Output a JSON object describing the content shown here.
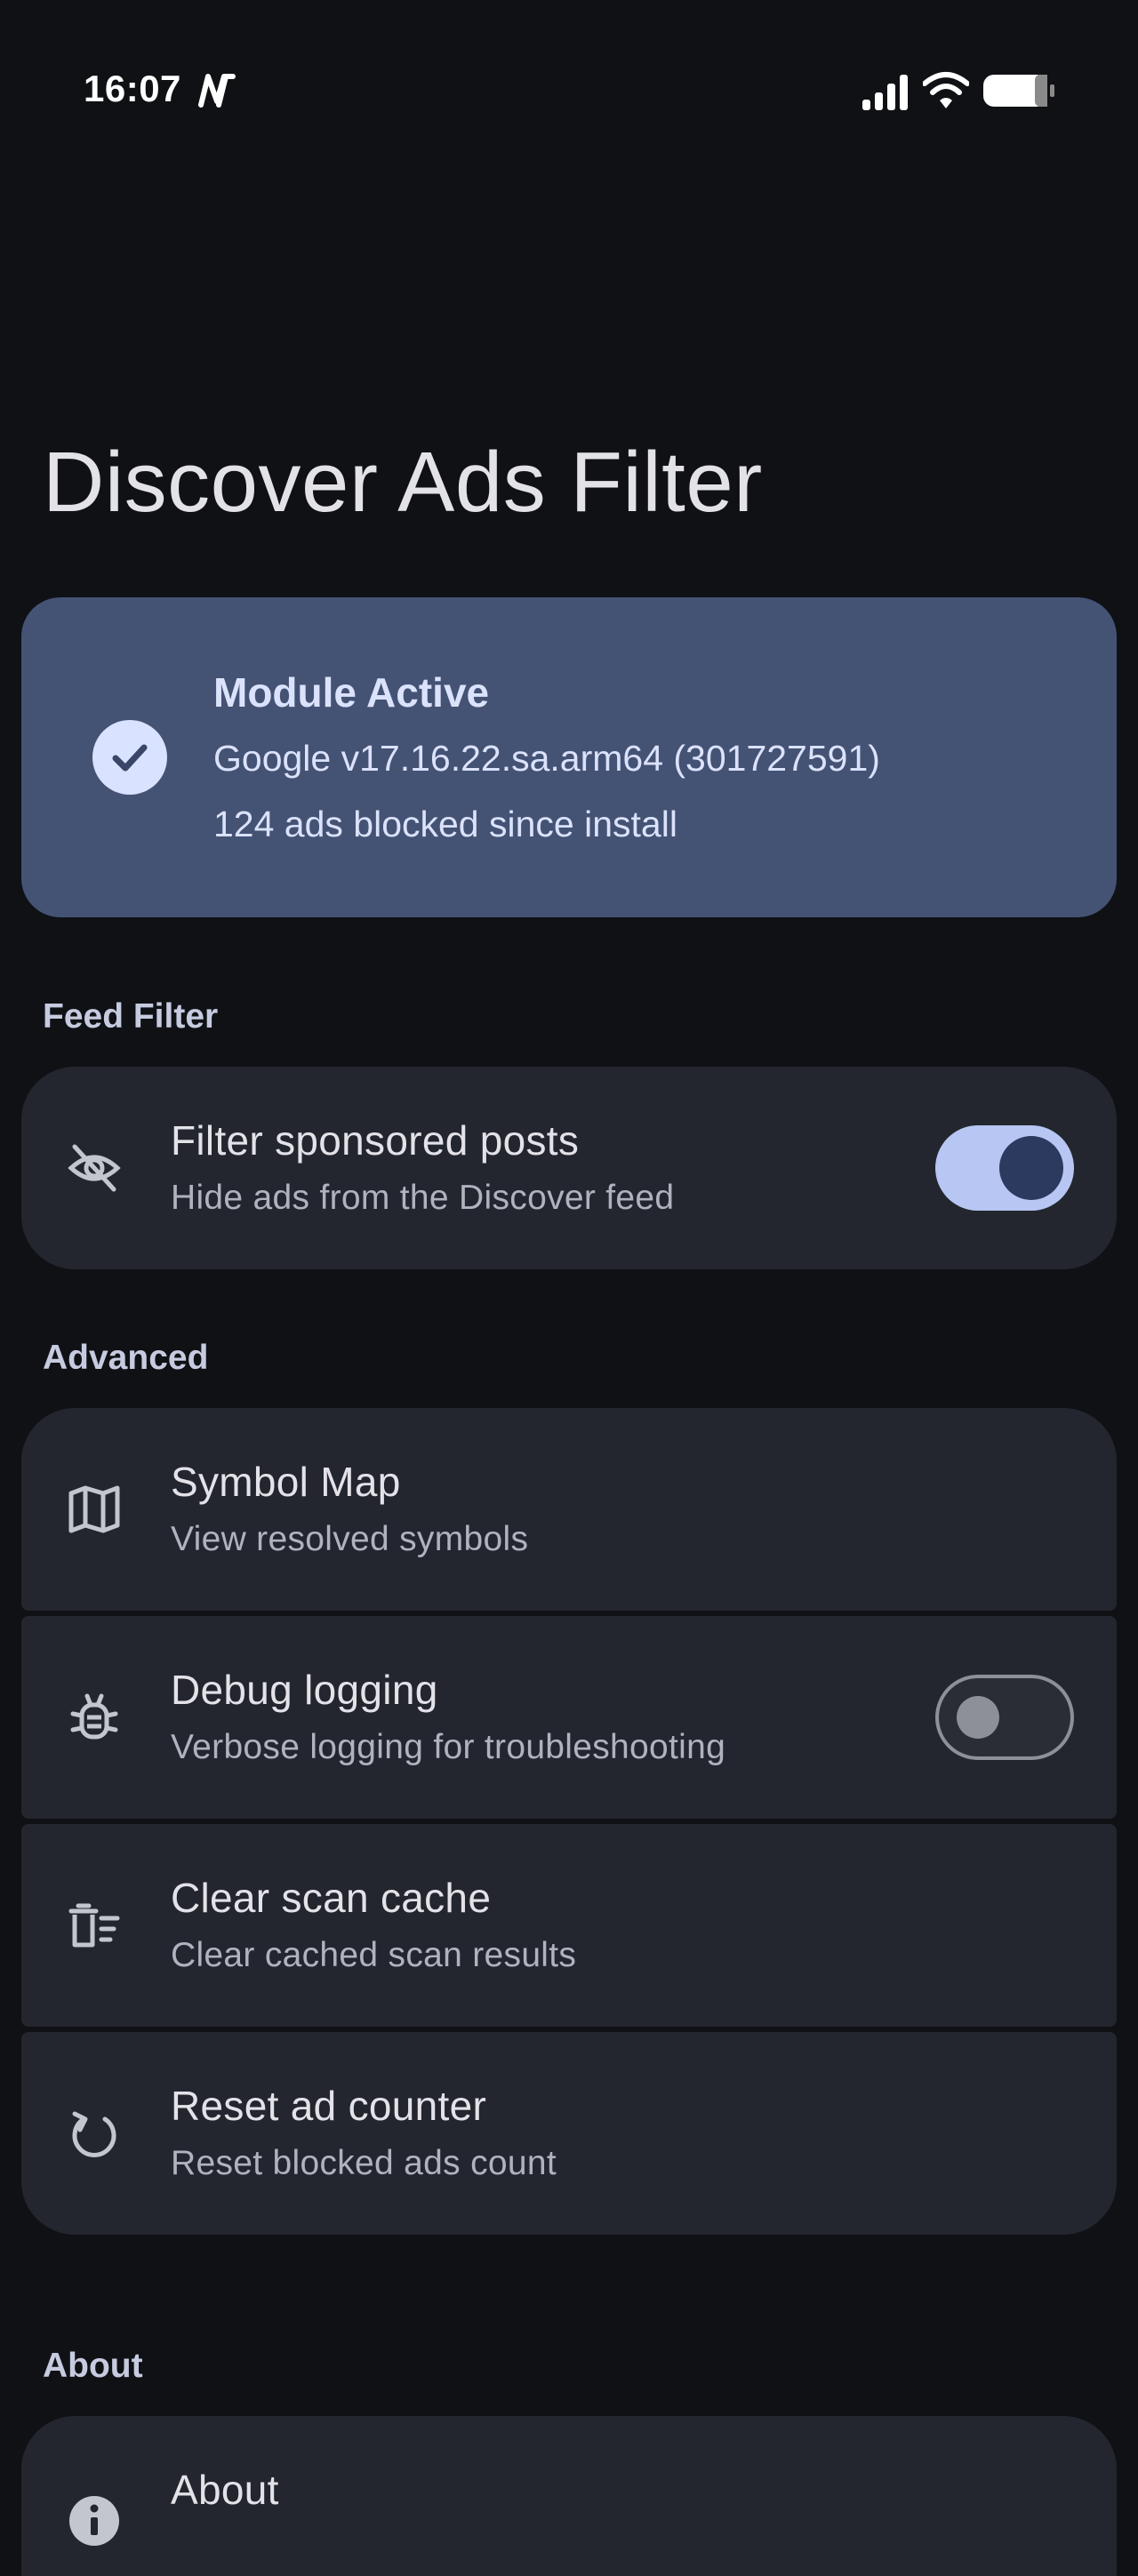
{
  "status_bar": {
    "time": "16:07",
    "app_icon": "n-notification-icon",
    "signal_icon": "cell-signal-icon",
    "wifi_icon": "wifi-icon",
    "battery_icon": "battery-icon"
  },
  "app": {
    "title": "Discover Ads Filter"
  },
  "module_card": {
    "title": "Module Active",
    "version": "Google v17.16.22.sa.arm64 (301727591)",
    "blocked": "124 ads blocked since install",
    "icon": "check-circle-icon"
  },
  "sections": {
    "feed_filter": {
      "label": "Feed Filter",
      "items": [
        {
          "title": "Filter sponsored posts",
          "subtitle": "Hide ads from the Discover feed",
          "icon": "eye-off-icon",
          "toggle": true
        }
      ]
    },
    "advanced": {
      "label": "Advanced",
      "items": [
        {
          "title": "Symbol Map",
          "subtitle": "View resolved symbols",
          "icon": "map-icon"
        },
        {
          "title": "Debug logging",
          "subtitle": "Verbose logging for troubleshooting",
          "icon": "bug-icon",
          "toggle": false
        },
        {
          "title": "Clear scan cache",
          "subtitle": "Clear cached scan results",
          "icon": "delete-sweep-icon"
        },
        {
          "title": "Reset ad counter",
          "subtitle": "Reset blocked ads count",
          "icon": "reset-icon"
        }
      ]
    },
    "about": {
      "label": "About",
      "items": [
        {
          "title": "About",
          "icon": "info-icon"
        }
      ]
    }
  },
  "colors": {
    "background": "#0f1115",
    "card": "#23262e",
    "module_card": "#445274",
    "accent": "#b7c6f2"
  }
}
